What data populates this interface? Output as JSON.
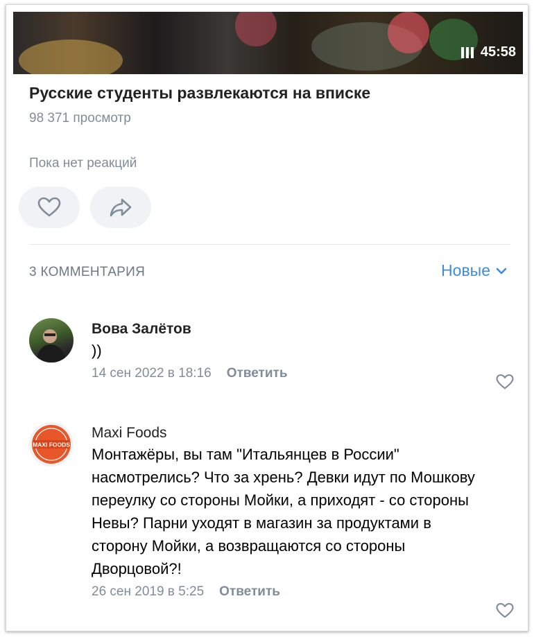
{
  "video": {
    "duration": "45:58",
    "title": "Русские студенты развлекаются на вписке",
    "views": "98 371 просмотр"
  },
  "reactions": {
    "empty_text": "Пока нет реакций"
  },
  "comments_header": {
    "count_label": "3 КОММЕНТАРИЯ",
    "sort_label": "Новые"
  },
  "comments": [
    {
      "author": "Вова Залётов",
      "text": "))",
      "date": "14 сен 2022 в 18:16",
      "reply_label": "Ответить"
    },
    {
      "author": "Maxi Foods",
      "avatar_text": "MAXI FOODS",
      "text": "Монтажёры, вы там \"Итальянцев в России\" насмотрелись? Что за хрень? Девки идут по Мошкову переулку со стороны Мойки, а приходят - со стороны Невы? Парни уходят в магазин за продуктами в сторону Мойки, а возвращаются со стороны Дворцовой?!",
      "date": "26 сен 2019 в 5:25",
      "reply_label": "Ответить"
    }
  ],
  "colors": {
    "accent": "#3f8ae0",
    "muted": "#818c99",
    "pill_bg": "#f0f2f5"
  }
}
